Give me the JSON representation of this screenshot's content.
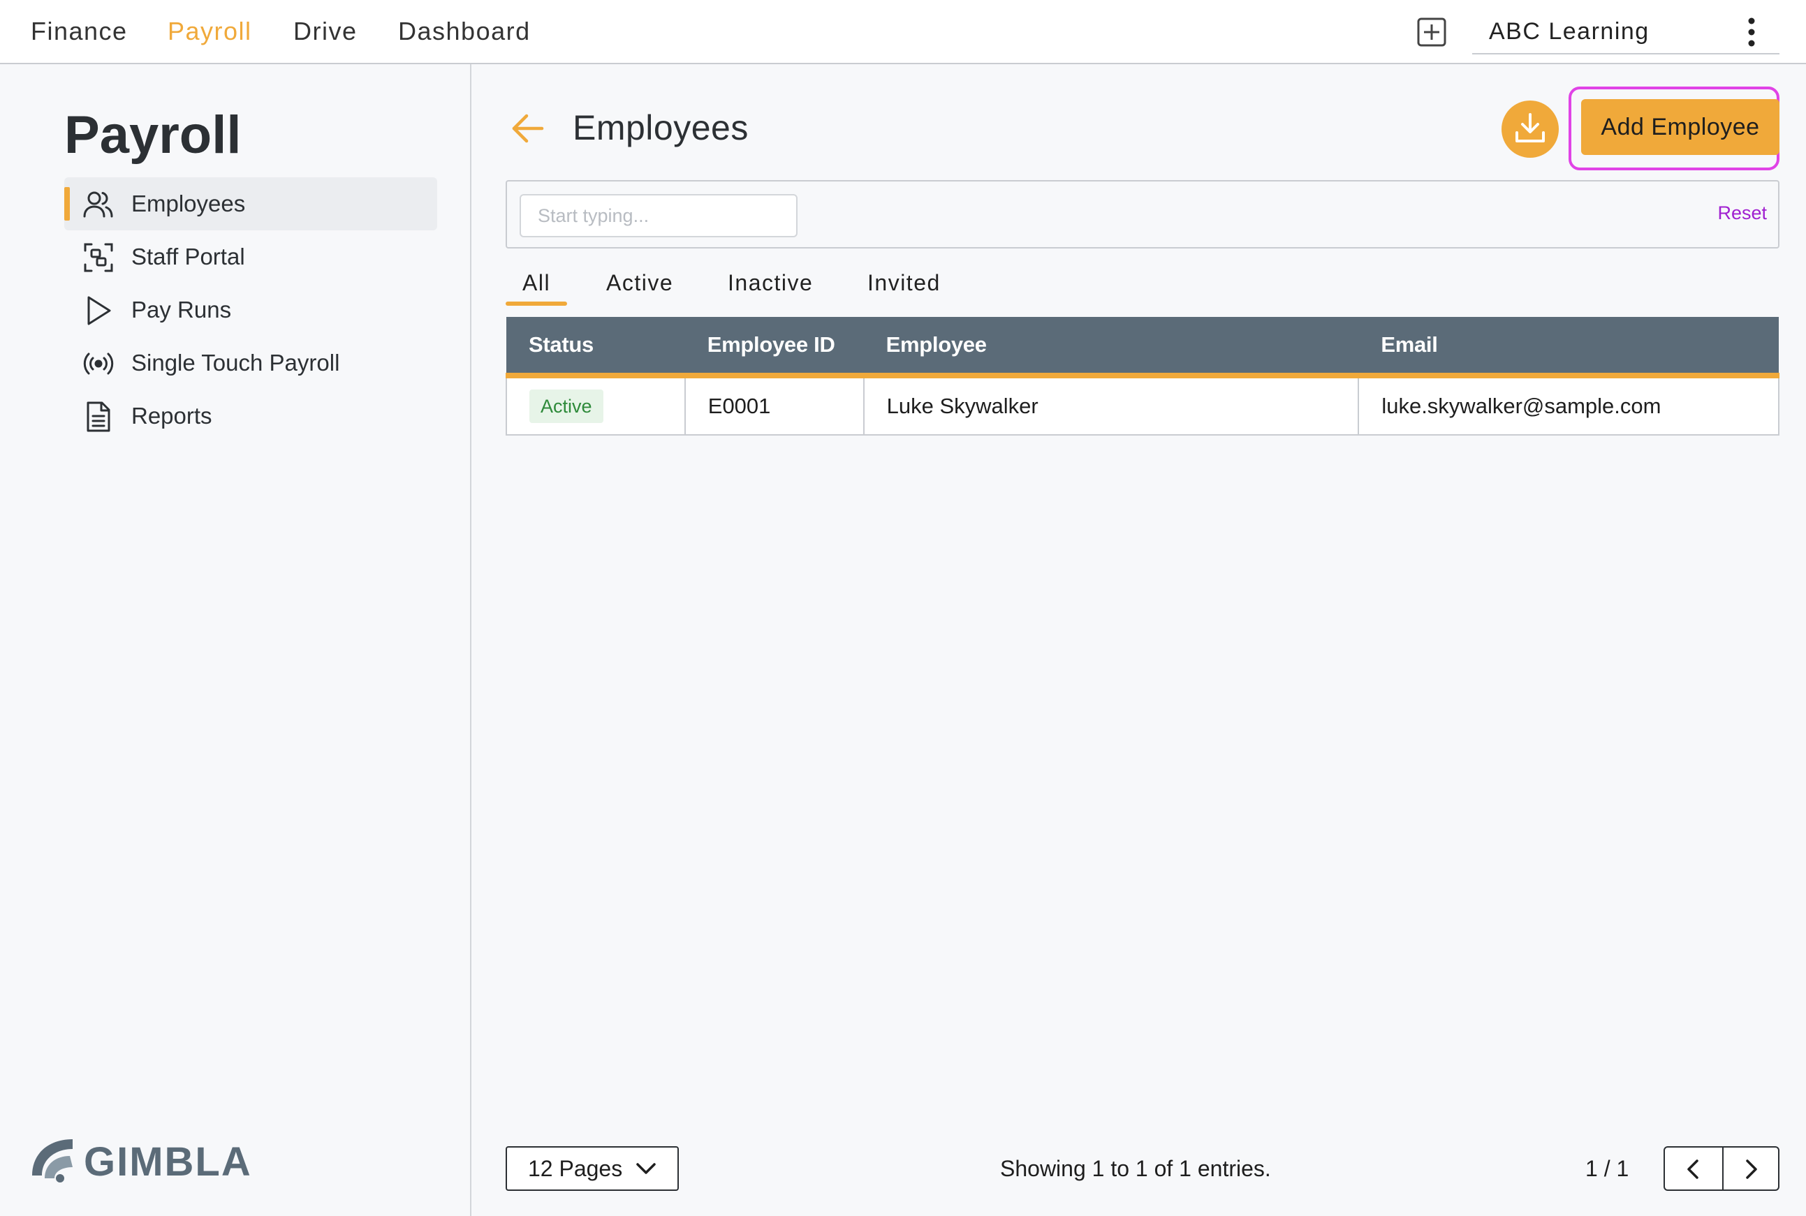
{
  "topnav": {
    "items": [
      {
        "label": "Finance",
        "active": false
      },
      {
        "label": "Payroll",
        "active": true
      },
      {
        "label": "Drive",
        "active": false
      },
      {
        "label": "Dashboard",
        "active": false
      }
    ],
    "org_name": "ABC Learning",
    "icons": {
      "add": "add-box-icon",
      "menu": "kebab-menu-icon"
    }
  },
  "sidebar": {
    "title": "Payroll",
    "items": [
      {
        "label": "Employees",
        "icon": "users-icon",
        "active": true
      },
      {
        "label": "Staff Portal",
        "icon": "scan-portal-icon",
        "active": false
      },
      {
        "label": "Pay Runs",
        "icon": "play-icon",
        "active": false
      },
      {
        "label": "Single Touch Payroll",
        "icon": "broadcast-icon",
        "active": false
      },
      {
        "label": "Reports",
        "icon": "document-icon",
        "active": false
      }
    ],
    "logo_text": "GIMBLA"
  },
  "main": {
    "title": "Employees",
    "add_button_label": "Add Employee",
    "search": {
      "placeholder": "Start typing...",
      "value": ""
    },
    "reset_label": "Reset",
    "tabs": [
      {
        "label": "All",
        "active": true
      },
      {
        "label": "Active",
        "active": false
      },
      {
        "label": "Inactive",
        "active": false
      },
      {
        "label": "Invited",
        "active": false
      }
    ],
    "table": {
      "columns": [
        "Status",
        "Employee ID",
        "Employee",
        "Email"
      ],
      "rows": [
        {
          "status": "Active",
          "employee_id": "E0001",
          "employee": "Luke Skywalker",
          "email": "luke.skywalker@sample.com"
        }
      ]
    },
    "footer": {
      "pages_select": "12 Pages",
      "entries_text": "Showing 1 to 1 of 1 entries.",
      "page_indicator": "1 / 1"
    }
  },
  "colors": {
    "accent": "#f0a93a",
    "header": "#5b6b78",
    "highlight": "#e043e6",
    "link": "#a020d0",
    "status_active": "#2e8a3a"
  }
}
